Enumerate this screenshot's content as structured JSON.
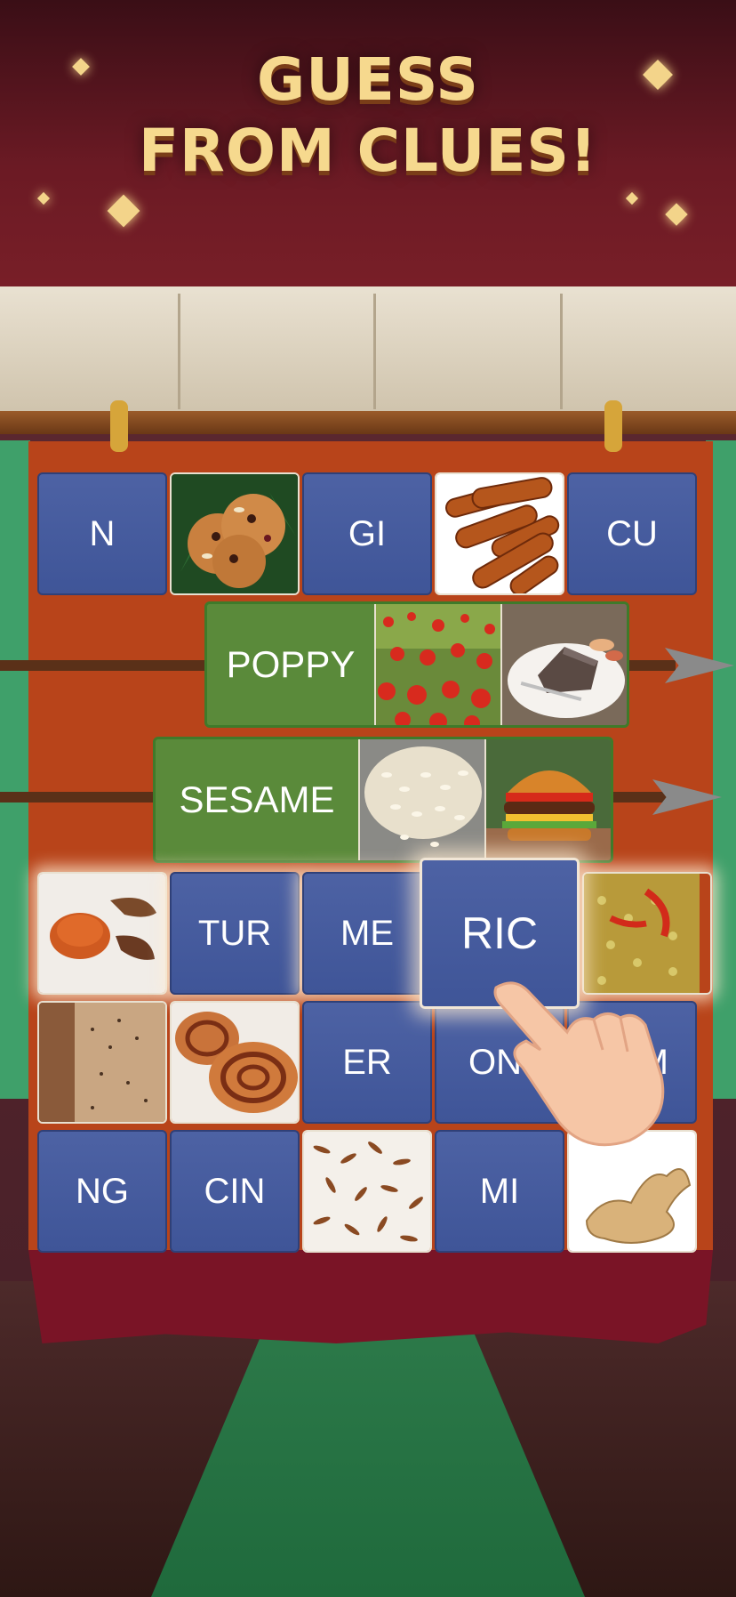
{
  "title_line1": "GUESS",
  "title_line2": "FROM CLUES!",
  "colors": {
    "letter_tile": "#4d62a4",
    "answer_bar": "#5a8a3a",
    "banner": "#b8441a",
    "title": "#f6d98e"
  },
  "solved": [
    {
      "word": "POPPY",
      "clues": [
        "poppy-field-photo",
        "poppy-seed-cake-photo"
      ]
    },
    {
      "word": "SESAME",
      "clues": [
        "sesame-seeds-photo",
        "burger-bun-photo"
      ]
    }
  ],
  "grid": {
    "row1": [
      "N",
      "gingerbread-cookies-photo",
      "GI",
      "cinnamon-sticks-photo",
      "CU"
    ],
    "row4": [
      "turmeric-powder-photo",
      "TUR",
      "ME",
      "RIC",
      "spiced-rice-photo"
    ],
    "row5": [
      "seeded-bread-photo",
      "cinnamon-rolls-photo",
      "ER",
      "ON",
      "M"
    ],
    "row6": [
      "NG",
      "CIN",
      "cumin-seeds-photo",
      "MI",
      "ginger-root-photo"
    ]
  },
  "selected_tile": "RIC",
  "hint": "pointing-hand-icon"
}
